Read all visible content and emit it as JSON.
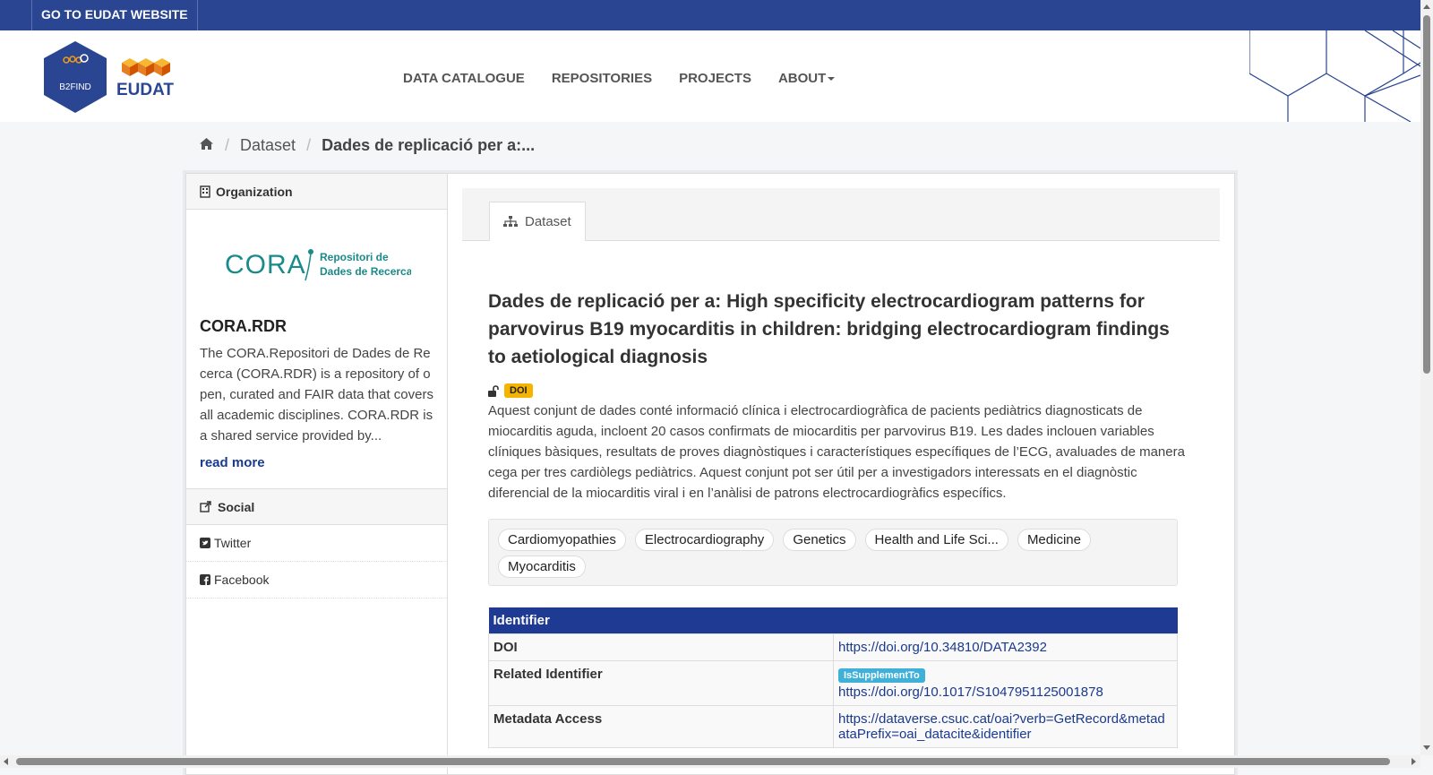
{
  "topbar": {
    "eudat_link": "GO TO EUDAT WEBSITE"
  },
  "logo": {
    "b2find": "B2FIND",
    "eudat": "EUDAT"
  },
  "nav": {
    "items": [
      {
        "label": "DATA CATALOGUE"
      },
      {
        "label": "REPOSITORIES"
      },
      {
        "label": "PROJECTS"
      },
      {
        "label": "ABOUT"
      }
    ]
  },
  "breadcrumb": {
    "dataset": "Dataset",
    "current": "Dades de replicació per a:..."
  },
  "sidebar": {
    "org_heading": "Organization",
    "org_logo": {
      "main": "CORA",
      "line1": "Repositori de",
      "line2": "Dades de Recerca"
    },
    "org_name": "CORA.RDR",
    "org_desc": "The CORA.Repositori de Dades de Recerca (CORA.RDR) is a repository of open, curated and FAIR data that covers all academic disciplines. CORA.RDR is a shared service provided by...",
    "read_more": "read more",
    "social_heading": "Social",
    "twitter": "Twitter",
    "facebook": "Facebook"
  },
  "content": {
    "tab": "Dataset",
    "title": "Dades de replicació per a: High specificity electrocardiogram patterns for parvovirus B19 myocarditis in children: bridging electrocardiogram findings to aetiological diagnosis",
    "doi_badge": "DOI",
    "description": "Aquest conjunt de dades conté informació clínica i electrocardiogràfica de pacients pediàtrics diagnosticats de miocarditis aguda, incloent 20 casos confirmats de miocarditis per parvovirus B19. Les dades inclouen variables clíniques bàsiques, resultats de proves diagnòstiques i característiques específiques de l’ECG, avaluades de manera cega per tres cardiòlegs pediàtrics. Aquest conjunt pot ser útil per a investigadors interessats en el diagnòstic diferencial de la miocarditis viral i en l’anàlisi de patrons electrocardiogràfics específics.",
    "tags": [
      "Cardiomyopathies",
      "Electrocardiography",
      "Genetics",
      "Health and Life Sci...",
      "Medicine",
      "Myocarditis"
    ],
    "identifier_table": {
      "heading": "Identifier",
      "doi_label": "DOI",
      "doi_url": "https://doi.org/10.34810/DATA2392",
      "related_label": "Related Identifier",
      "related_badge": "IsSupplementTo",
      "related_url": "https://doi.org/10.1017/S1047951125001878",
      "metadata_label": "Metadata Access",
      "metadata_url": "https://dataverse.csuc.cat/oai?verb=GetRecord&metadataPrefix=oai_datacite&identifier"
    }
  },
  "colors": {
    "topbar": "#2a4592",
    "table_header": "#1f3a93",
    "link": "#1a3a8f",
    "doi_badge": "#f5b400",
    "relation_badge": "#3fb0d8",
    "cora_teal": "#1a8a8a"
  }
}
